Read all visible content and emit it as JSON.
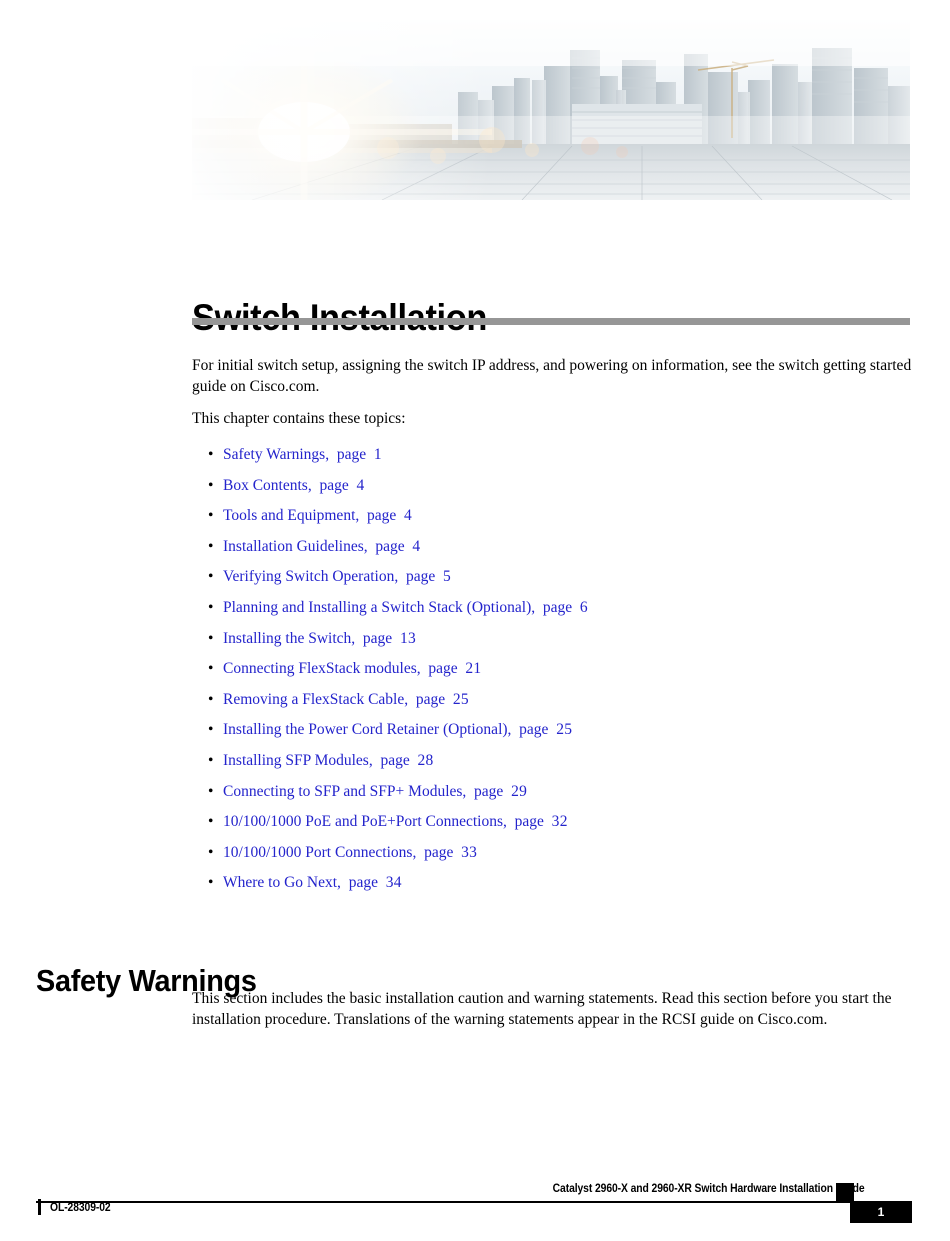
{
  "banner": {
    "alt": "city-skyline-plaza-banner",
    "sky_color": "#f2f6f8",
    "plaza_color": "#d8dde0",
    "building_color": "#c3ccd2",
    "flare_color": "#fff8e8"
  },
  "chapter": {
    "title": "Switch Installation",
    "rule_color": "#969696",
    "intro_paragraph": "For initial switch setup, assigning the switch IP address, and powering on information, see the switch getting started guide on Cisco.com.",
    "topics_lead_in": "This chapter contains these topics:",
    "bullet_glyph": "•",
    "link_color": "#2424cc",
    "topics": [
      {
        "label": "Safety Warnings,",
        "page_label": "page",
        "page": "1"
      },
      {
        "label": "Box Contents,",
        "page_label": "page",
        "page": "4"
      },
      {
        "label": "Tools and Equipment,",
        "page_label": "page",
        "page": "4"
      },
      {
        "label": "Installation Guidelines,",
        "page_label": "page",
        "page": "4"
      },
      {
        "label": "Verifying Switch Operation,",
        "page_label": "page",
        "page": "5"
      },
      {
        "label": "Planning and Installing a Switch Stack (Optional),",
        "page_label": "page",
        "page": "6"
      },
      {
        "label": "Installing the Switch,",
        "page_label": "page",
        "page": "13"
      },
      {
        "label": "Connecting FlexStack modules,",
        "page_label": "page",
        "page": "21"
      },
      {
        "label": "Removing a FlexStack Cable,",
        "page_label": "page",
        "page": "25"
      },
      {
        "label": "Installing the Power Cord Retainer (Optional),",
        "page_label": "page",
        "page": "25"
      },
      {
        "label": "Installing SFP Modules,",
        "page_label": "page",
        "page": "28"
      },
      {
        "label": "Connecting to SFP and SFP+ Modules,",
        "page_label": "page",
        "page": "29"
      },
      {
        "label": "10/100/1000 PoE and PoE+Port Connections,",
        "page_label": "page",
        "page": "32"
      },
      {
        "label": "10/100/1000 Port Connections,",
        "page_label": "page",
        "page": "33"
      },
      {
        "label": "Where to Go Next,",
        "page_label": "page",
        "page": "34"
      }
    ]
  },
  "safety_section": {
    "heading": "Safety Warnings",
    "paragraph": "This section includes the basic installation caution and warning statements. Read this section before you start the installation procedure. Translations of the warning statements appear in the RCSI guide on Cisco.com."
  },
  "footer": {
    "guide_title": "Catalyst 2960-X and 2960-XR Switch Hardware Installation Guide",
    "doc_id": "OL-28309-02",
    "page_number": "1"
  }
}
